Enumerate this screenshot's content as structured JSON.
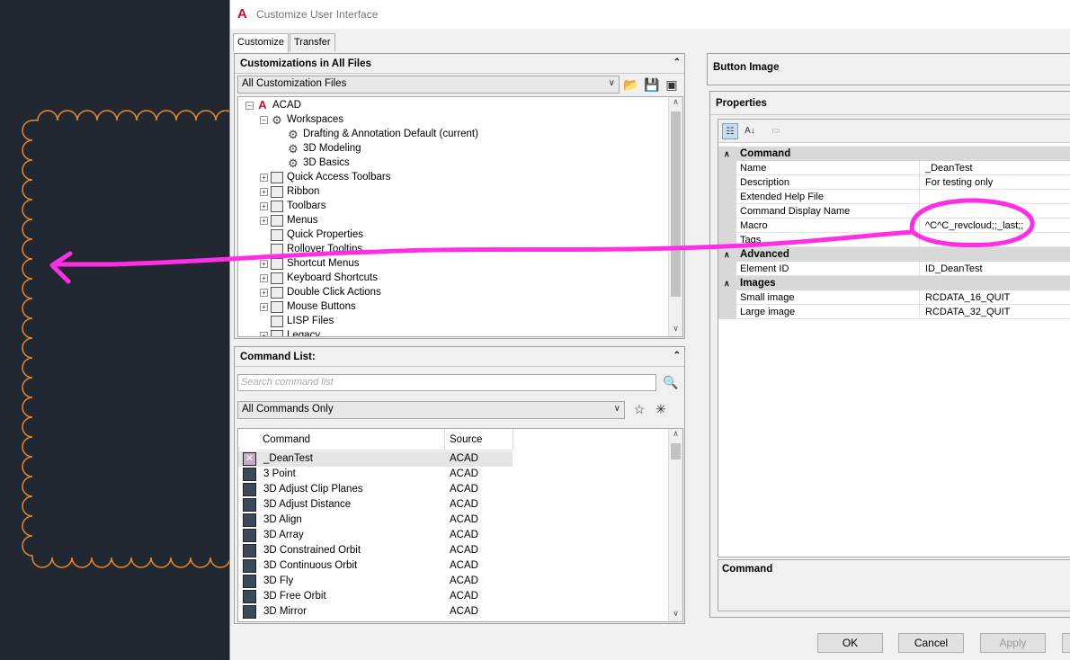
{
  "window": {
    "title": "Customize User Interface"
  },
  "tabs": [
    {
      "label": "Customize"
    },
    {
      "label": "Transfer"
    }
  ],
  "customizations": {
    "header": "Customizations in All Files",
    "filter": "All Customization Files",
    "tree": [
      {
        "label": "ACAD",
        "icon": "acad-icon"
      },
      {
        "label": "Workspaces",
        "icon": "gear-icon"
      },
      {
        "label": "Drafting & Annotation Default (current)",
        "icon": "gear-icon"
      },
      {
        "label": "3D Modeling",
        "icon": "gear-icon"
      },
      {
        "label": "3D Basics",
        "icon": "gear-icon"
      },
      {
        "label": "Quick Access Toolbars",
        "icon": "toolbar-icon"
      },
      {
        "label": "Ribbon",
        "icon": "folder-icon"
      },
      {
        "label": "Toolbars",
        "icon": "toolbar-icon"
      },
      {
        "label": "Menus",
        "icon": "menu-icon"
      },
      {
        "label": "Quick Properties",
        "icon": "properties-icon"
      },
      {
        "label": "Rollover Tooltips",
        "icon": "tooltip-icon"
      },
      {
        "label": "Shortcut Menus",
        "icon": "menu-icon"
      },
      {
        "label": "Keyboard Shortcuts",
        "icon": "keyboard-icon"
      },
      {
        "label": "Double Click Actions",
        "icon": "mouse-icon"
      },
      {
        "label": "Mouse Buttons",
        "icon": "mouse-icon"
      },
      {
        "label": "LISP Files",
        "icon": "lisp-icon"
      },
      {
        "label": "Legacy",
        "icon": "legacy-icon"
      }
    ]
  },
  "command_list": {
    "header": "Command List:",
    "search_placeholder": "Search command list",
    "filter": "All Commands Only",
    "columns": {
      "command": "Command",
      "source": "Source"
    },
    "rows": [
      {
        "name": "_DeanTest",
        "source": "ACAD"
      },
      {
        "name": "3 Point",
        "source": "ACAD"
      },
      {
        "name": "3D Adjust Clip Planes",
        "source": "ACAD"
      },
      {
        "name": "3D Adjust Distance",
        "source": "ACAD"
      },
      {
        "name": "3D Align",
        "source": "ACAD"
      },
      {
        "name": "3D Array",
        "source": "ACAD"
      },
      {
        "name": "3D Constrained Orbit",
        "source": "ACAD"
      },
      {
        "name": "3D Continuous Orbit",
        "source": "ACAD"
      },
      {
        "name": "3D Fly",
        "source": "ACAD"
      },
      {
        "name": "3D Free Orbit",
        "source": "ACAD"
      },
      {
        "name": "3D Mirror",
        "source": "ACAD"
      }
    ]
  },
  "button_image": {
    "header": "Button Image"
  },
  "properties": {
    "header": "Properties",
    "categories": {
      "command": "Command",
      "advanced": "Advanced",
      "images": "Images"
    },
    "rows": {
      "name": {
        "label": "Name",
        "value": "_DeanTest"
      },
      "description": {
        "label": "Description",
        "value": "For testing only"
      },
      "help_file": {
        "label": "Extended Help File",
        "value": ""
      },
      "display_name": {
        "label": "Command Display Name",
        "value": ""
      },
      "macro": {
        "label": "Macro",
        "value": "^C^C_revcloud;;_last;;"
      },
      "tags": {
        "label": "Tags",
        "value": ""
      },
      "element_id": {
        "label": "Element ID",
        "value": "ID_DeanTest"
      },
      "small_image": {
        "label": "Small image",
        "value": "RCDATA_16_QUIT"
      },
      "large_image": {
        "label": "Large image",
        "value": "RCDATA_32_QUIT"
      }
    },
    "description_panel": {
      "title": "Command"
    }
  },
  "buttons": {
    "ok": "OK",
    "cancel": "Cancel",
    "apply": "Apply"
  },
  "colors": {
    "annotation": "#ff2ee6",
    "revcloud": "#e8892a",
    "canvas": "#222831"
  }
}
